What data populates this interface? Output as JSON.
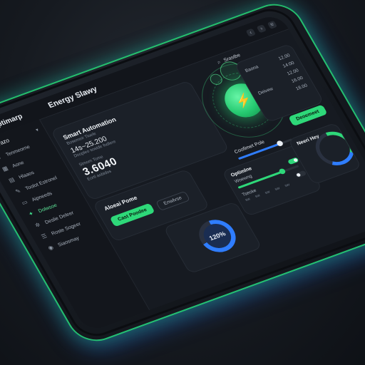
{
  "app": {
    "name": "Optimarp",
    "title": "Energy Slawy"
  },
  "window_controls": [
    "‹",
    "›",
    "≡"
  ],
  "sidebar": {
    "header": "Nenrazo",
    "items": [
      {
        "label": "Tenmeorne",
        "icon": "home-icon",
        "active": false
      },
      {
        "label": "Aone",
        "icon": "grid-icon",
        "active": false
      },
      {
        "label": "Hlaaos",
        "icon": "chart-icon",
        "active": false
      },
      {
        "label": "Toolot Estronel",
        "icon": "tools-icon",
        "active": false
      },
      {
        "label": "Aipneeds",
        "icon": "folder-icon",
        "active": false
      },
      {
        "label": "Dolwsoe",
        "icon": "settings-icon",
        "active": true
      },
      {
        "label": "Deslie Deleer",
        "icon": "gear-icon",
        "active": false
      },
      {
        "label": "Roste Sogeer",
        "icon": "list-icon",
        "active": false
      },
      {
        "label": "Siaosmay",
        "icon": "user-icon",
        "active": false
      }
    ]
  },
  "header": {
    "search_label": "Srastbe"
  },
  "automation": {
    "title": "Smart Automation",
    "subtitle": "Bosemeir Tioele",
    "stat_value": "14s~25.200",
    "stat_caption": "Doopleo sostde fodlere",
    "metric_label": "Stmom Tome",
    "metric_value": "3.6040",
    "metric_caption": "Eortl aobidos"
  },
  "orb": {
    "symbol": "⚡"
  },
  "top_right_card": {
    "rows": [
      {
        "label": "Baona",
        "value": "12.00"
      },
      {
        "label": "",
        "value": "14:00"
      },
      {
        "label": "",
        "value": "12.00"
      },
      {
        "label": "Deivew",
        "value": "16.00"
      },
      {
        "label": "",
        "value": "18.00"
      }
    ],
    "button": "Deoemeet"
  },
  "power_slider": {
    "label": "Coofimet Pole",
    "level": 0.78
  },
  "action_card": {
    "title": "Aloeai Pome",
    "primary": "Cast Poodee",
    "secondary": "Enwlvse"
  },
  "optimize_card": {
    "title": "Optimlne",
    "rows": [
      {
        "label": "Woewng",
        "on": true
      },
      {
        "label": "Tsecke",
        "on": false
      }
    ],
    "level": 0.72,
    "footer": [
      "sw",
      "sw",
      "sw",
      "sw",
      "sw"
    ]
  },
  "gauge_card": {
    "value": "120%",
    "progress": 0.72
  },
  "right_card": {
    "title": "Neeri Hey"
  },
  "colors": {
    "accent": "#2ed879",
    "blue": "#2f7dff"
  }
}
